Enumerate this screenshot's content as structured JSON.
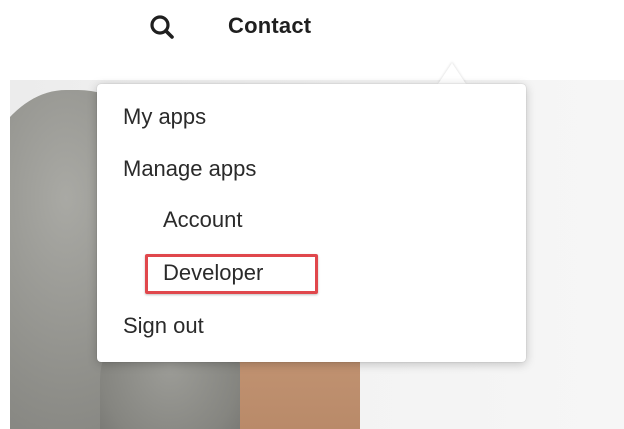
{
  "nav": {
    "search_icon": "search-icon",
    "contact_label": "Contact"
  },
  "menu": {
    "items": [
      {
        "label": "My apps"
      },
      {
        "label": "Manage apps"
      },
      {
        "label": "Account"
      },
      {
        "label": "Developer",
        "highlighted": true
      },
      {
        "label": "Sign out"
      }
    ]
  },
  "colors": {
    "text": "#2a2a2a",
    "highlight_border": "#e0474c",
    "menu_bg": "#ffffff"
  }
}
